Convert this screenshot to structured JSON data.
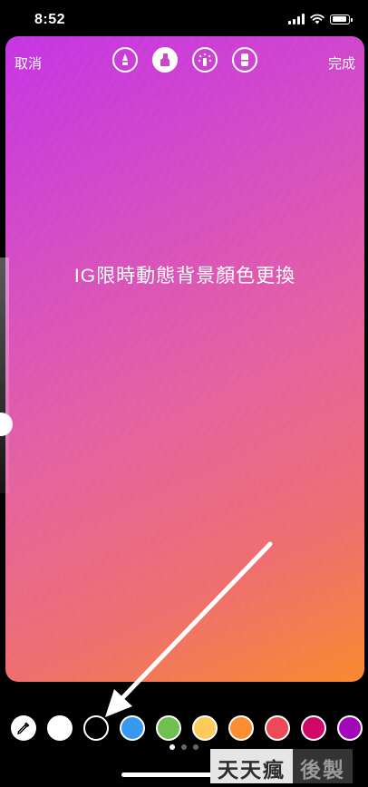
{
  "status": {
    "time": "8:52",
    "battery_level": 0.9
  },
  "toolbar": {
    "cancel_label": "取消",
    "done_label": "完成"
  },
  "tools": [
    {
      "icon": "pen-icon",
      "active": false
    },
    {
      "icon": "marker-icon",
      "active": true
    },
    {
      "icon": "neon-icon",
      "active": false
    },
    {
      "icon": "eraser-icon",
      "active": false
    }
  ],
  "canvas": {
    "caption": "IG限時動態背景顏色更換",
    "gradient": [
      "#c535e3",
      "#f9892f"
    ]
  },
  "palette": {
    "eyedropper_icon": "eyedropper-icon",
    "colors": [
      "#ffffff",
      "#000000",
      "#3897f0",
      "#70c050",
      "#fdcb5c",
      "#fd8d32",
      "#ed4956",
      "#d10869",
      "#a307ba"
    ],
    "selected_index": 1
  },
  "pagination": {
    "count": 3,
    "active": 0
  },
  "watermark": {
    "part1": "天天瘋",
    "part2": "後製"
  }
}
